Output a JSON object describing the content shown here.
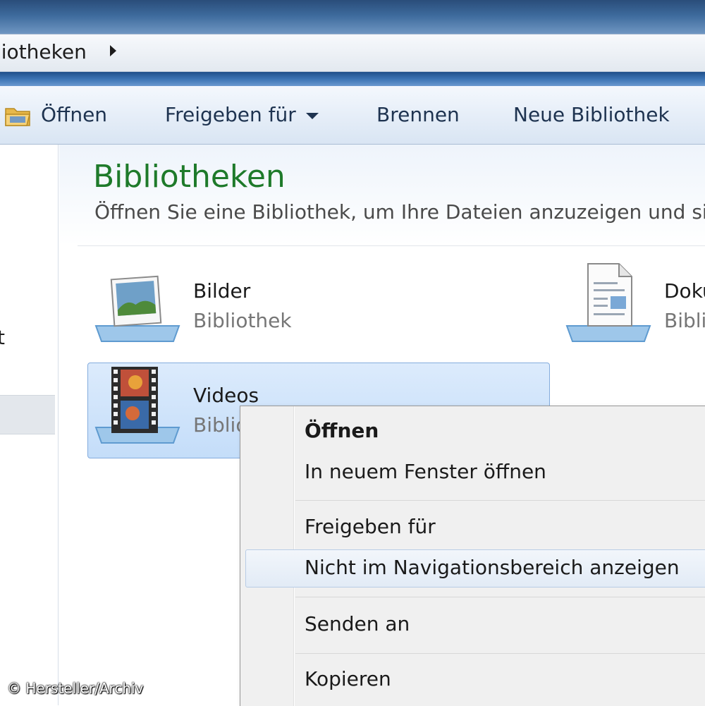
{
  "addressbar": {
    "breadcrumb": "liotheken"
  },
  "toolbar": {
    "open_label": "Öffnen",
    "share_label": "Freigeben für",
    "burn_label": "Brennen",
    "new_library_label": "Neue Bibliothek"
  },
  "navpane": {
    "partial_item": "t"
  },
  "main": {
    "title": "Bibliotheken",
    "subtitle": "Öffnen Sie eine Bibliothek, um Ihre Dateien anzuzeigen und sie",
    "libraries": [
      {
        "name": "Bilder",
        "type": "Bibliothek",
        "icon": "pictures-library-icon"
      },
      {
        "name": "Doku",
        "type": "Bibli",
        "icon": "documents-library-icon"
      },
      {
        "name": "Videos",
        "type": "Biblio",
        "icon": "videos-library-icon",
        "selected": true
      }
    ]
  },
  "context_menu": {
    "items": [
      {
        "label": "Öffnen",
        "bold": true
      },
      {
        "label": "In neuem Fenster öffnen"
      },
      {
        "label": "Freigeben für"
      },
      {
        "label": "Nicht im Navigationsbereich anzeigen",
        "hovered": true
      },
      {
        "label": "Senden an"
      },
      {
        "label": "Kopieren"
      }
    ]
  },
  "watermark": "© Hersteller/Archiv",
  "colors": {
    "title_green": "#1e7a2a",
    "selection_blue": "#c4ddf9",
    "toolbar_text": "#1e3350"
  }
}
